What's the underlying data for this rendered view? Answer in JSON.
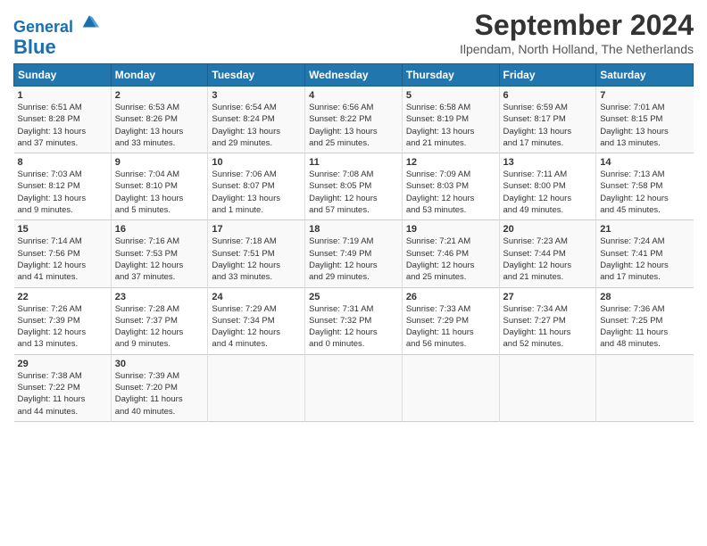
{
  "header": {
    "logo_line1": "General",
    "logo_line2": "Blue",
    "month": "September 2024",
    "location": "Ilpendam, North Holland, The Netherlands"
  },
  "days_of_week": [
    "Sunday",
    "Monday",
    "Tuesday",
    "Wednesday",
    "Thursday",
    "Friday",
    "Saturday"
  ],
  "weeks": [
    [
      {
        "day": "1",
        "lines": [
          "Sunrise: 6:51 AM",
          "Sunset: 8:28 PM",
          "Daylight: 13 hours",
          "and 37 minutes."
        ]
      },
      {
        "day": "2",
        "lines": [
          "Sunrise: 6:53 AM",
          "Sunset: 8:26 PM",
          "Daylight: 13 hours",
          "and 33 minutes."
        ]
      },
      {
        "day": "3",
        "lines": [
          "Sunrise: 6:54 AM",
          "Sunset: 8:24 PM",
          "Daylight: 13 hours",
          "and 29 minutes."
        ]
      },
      {
        "day": "4",
        "lines": [
          "Sunrise: 6:56 AM",
          "Sunset: 8:22 PM",
          "Daylight: 13 hours",
          "and 25 minutes."
        ]
      },
      {
        "day": "5",
        "lines": [
          "Sunrise: 6:58 AM",
          "Sunset: 8:19 PM",
          "Daylight: 13 hours",
          "and 21 minutes."
        ]
      },
      {
        "day": "6",
        "lines": [
          "Sunrise: 6:59 AM",
          "Sunset: 8:17 PM",
          "Daylight: 13 hours",
          "and 17 minutes."
        ]
      },
      {
        "day": "7",
        "lines": [
          "Sunrise: 7:01 AM",
          "Sunset: 8:15 PM",
          "Daylight: 13 hours",
          "and 13 minutes."
        ]
      }
    ],
    [
      {
        "day": "8",
        "lines": [
          "Sunrise: 7:03 AM",
          "Sunset: 8:12 PM",
          "Daylight: 13 hours",
          "and 9 minutes."
        ]
      },
      {
        "day": "9",
        "lines": [
          "Sunrise: 7:04 AM",
          "Sunset: 8:10 PM",
          "Daylight: 13 hours",
          "and 5 minutes."
        ]
      },
      {
        "day": "10",
        "lines": [
          "Sunrise: 7:06 AM",
          "Sunset: 8:07 PM",
          "Daylight: 13 hours",
          "and 1 minute."
        ]
      },
      {
        "day": "11",
        "lines": [
          "Sunrise: 7:08 AM",
          "Sunset: 8:05 PM",
          "Daylight: 12 hours",
          "and 57 minutes."
        ]
      },
      {
        "day": "12",
        "lines": [
          "Sunrise: 7:09 AM",
          "Sunset: 8:03 PM",
          "Daylight: 12 hours",
          "and 53 minutes."
        ]
      },
      {
        "day": "13",
        "lines": [
          "Sunrise: 7:11 AM",
          "Sunset: 8:00 PM",
          "Daylight: 12 hours",
          "and 49 minutes."
        ]
      },
      {
        "day": "14",
        "lines": [
          "Sunrise: 7:13 AM",
          "Sunset: 7:58 PM",
          "Daylight: 12 hours",
          "and 45 minutes."
        ]
      }
    ],
    [
      {
        "day": "15",
        "lines": [
          "Sunrise: 7:14 AM",
          "Sunset: 7:56 PM",
          "Daylight: 12 hours",
          "and 41 minutes."
        ]
      },
      {
        "day": "16",
        "lines": [
          "Sunrise: 7:16 AM",
          "Sunset: 7:53 PM",
          "Daylight: 12 hours",
          "and 37 minutes."
        ]
      },
      {
        "day": "17",
        "lines": [
          "Sunrise: 7:18 AM",
          "Sunset: 7:51 PM",
          "Daylight: 12 hours",
          "and 33 minutes."
        ]
      },
      {
        "day": "18",
        "lines": [
          "Sunrise: 7:19 AM",
          "Sunset: 7:49 PM",
          "Daylight: 12 hours",
          "and 29 minutes."
        ]
      },
      {
        "day": "19",
        "lines": [
          "Sunrise: 7:21 AM",
          "Sunset: 7:46 PM",
          "Daylight: 12 hours",
          "and 25 minutes."
        ]
      },
      {
        "day": "20",
        "lines": [
          "Sunrise: 7:23 AM",
          "Sunset: 7:44 PM",
          "Daylight: 12 hours",
          "and 21 minutes."
        ]
      },
      {
        "day": "21",
        "lines": [
          "Sunrise: 7:24 AM",
          "Sunset: 7:41 PM",
          "Daylight: 12 hours",
          "and 17 minutes."
        ]
      }
    ],
    [
      {
        "day": "22",
        "lines": [
          "Sunrise: 7:26 AM",
          "Sunset: 7:39 PM",
          "Daylight: 12 hours",
          "and 13 minutes."
        ]
      },
      {
        "day": "23",
        "lines": [
          "Sunrise: 7:28 AM",
          "Sunset: 7:37 PM",
          "Daylight: 12 hours",
          "and 9 minutes."
        ]
      },
      {
        "day": "24",
        "lines": [
          "Sunrise: 7:29 AM",
          "Sunset: 7:34 PM",
          "Daylight: 12 hours",
          "and 4 minutes."
        ]
      },
      {
        "day": "25",
        "lines": [
          "Sunrise: 7:31 AM",
          "Sunset: 7:32 PM",
          "Daylight: 12 hours",
          "and 0 minutes."
        ]
      },
      {
        "day": "26",
        "lines": [
          "Sunrise: 7:33 AM",
          "Sunset: 7:29 PM",
          "Daylight: 11 hours",
          "and 56 minutes."
        ]
      },
      {
        "day": "27",
        "lines": [
          "Sunrise: 7:34 AM",
          "Sunset: 7:27 PM",
          "Daylight: 11 hours",
          "and 52 minutes."
        ]
      },
      {
        "day": "28",
        "lines": [
          "Sunrise: 7:36 AM",
          "Sunset: 7:25 PM",
          "Daylight: 11 hours",
          "and 48 minutes."
        ]
      }
    ],
    [
      {
        "day": "29",
        "lines": [
          "Sunrise: 7:38 AM",
          "Sunset: 7:22 PM",
          "Daylight: 11 hours",
          "and 44 minutes."
        ]
      },
      {
        "day": "30",
        "lines": [
          "Sunrise: 7:39 AM",
          "Sunset: 7:20 PM",
          "Daylight: 11 hours",
          "and 40 minutes."
        ]
      },
      {
        "day": "",
        "lines": []
      },
      {
        "day": "",
        "lines": []
      },
      {
        "day": "",
        "lines": []
      },
      {
        "day": "",
        "lines": []
      },
      {
        "day": "",
        "lines": []
      }
    ]
  ]
}
